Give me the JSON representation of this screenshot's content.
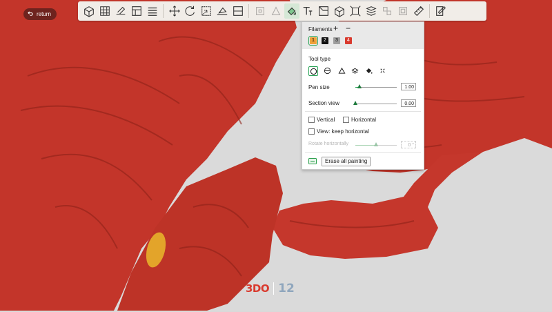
{
  "viewport": {
    "return_label": "return",
    "model_color": "#c3352a",
    "background_color": "#d9d9d9",
    "painted_patch_color": "#e3a42a"
  },
  "toolbar": {
    "icons": [
      "add-cube-icon",
      "grid-plate-icon",
      "plate-edit-icon",
      "plate-layout-icon",
      "menu-lines-icon",
      "move-icon",
      "rotate-icon",
      "scale-icon",
      "lay-on-face-icon",
      "cut-icon",
      "support-paint-icon",
      "seam-paint-icon",
      "color-paint-icon",
      "text-icon",
      "emboss-icon",
      "box-icon",
      "measure-frame-icon",
      "layers-icon",
      "assembly-icon",
      "brim-icon",
      "ruler-icon",
      "settings-edit-icon"
    ]
  },
  "panel": {
    "filaments_title": "Filaments",
    "add_symbol": "+",
    "remove_symbol": "−",
    "filaments": [
      {
        "number": "1",
        "color": "#f0a23a",
        "text_color": "#000000",
        "selected": true
      },
      {
        "number": "2",
        "color": "#111111",
        "text_color": "#ffffff",
        "selected": false
      },
      {
        "number": "3",
        "color": "#9e9e9e",
        "text_color": "#000000",
        "selected": false
      },
      {
        "number": "4",
        "color": "#d93a2e",
        "text_color": "#ffffff",
        "selected": false
      }
    ],
    "tool_type_label": "Tool type",
    "tools": [
      "circle-tool-icon",
      "sphere-tool-icon",
      "triangle-tool-icon",
      "height-range-icon",
      "fill-bucket-icon",
      "gap-fill-icon"
    ],
    "pen_size_label": "Pen size",
    "pen_size_value": "1.00",
    "pen_size_fraction": 0.1,
    "section_view_label": "Section view",
    "section_view_value": "0.00",
    "section_view_fraction": 0.0,
    "vertical_label": "Vertical",
    "horizontal_label": "Horizontal",
    "keep_horizontal_label": "View: keep horizontal",
    "rotate_label": "Rotate horizontally",
    "rotate_value": "0 °",
    "rotate_fraction": 0.5,
    "erase_label": "Erase all painting"
  },
  "watermark": {
    "left_text": "3DO",
    "right_text": "12",
    "left_color": "#d93a2e"
  }
}
